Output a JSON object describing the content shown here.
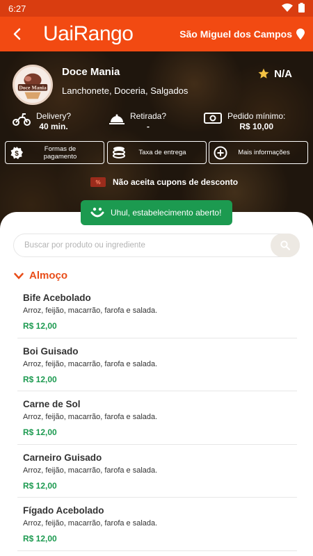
{
  "status_bar": {
    "time": "6:27"
  },
  "app_bar": {
    "logo": "UaiRango",
    "city": "São Miguel dos Campos"
  },
  "store": {
    "name": "Doce Mania",
    "categories": "Lanchonete, Doceria, Salgados",
    "rating": "N/A",
    "logo_text": "Doce Mania",
    "delivery": {
      "label": "Delivery?",
      "value": "40 min."
    },
    "pickup": {
      "label": "Retirada?",
      "value": "-"
    },
    "min_order": {
      "label": "Pedido mínimo:",
      "value": "R$ 10,00"
    },
    "buttons": {
      "payment": "Formas de pagamento",
      "fee": "Taxa de entrega",
      "more": "Mais informações"
    },
    "coupon_notice": "Não aceita cupons de desconto",
    "coupon_tag": "%",
    "open_status": "Uhul, estabelecimento aberto!"
  },
  "search": {
    "placeholder": "Buscar por produto ou ingrediente"
  },
  "section": {
    "title": "Almoço"
  },
  "items": [
    {
      "name": "Bife Acebolado",
      "desc": "Arroz, feijão, macarrão, farofa e salada.",
      "price": "R$ 12,00"
    },
    {
      "name": "Boi Guisado",
      "desc": "Arroz, feijão, macarrão, farofa e salada.",
      "price": "R$ 12,00"
    },
    {
      "name": "Carne de Sol",
      "desc": "Arroz, feijão, macarrão, farofa e salada.",
      "price": "R$ 12,00"
    },
    {
      "name": "Carneiro Guisado",
      "desc": "Arroz, feijão, macarrão, farofa e salada.",
      "price": "R$ 12,00"
    },
    {
      "name": "Fígado Acebolado",
      "desc": "Arroz, feijão, macarrão, farofa e salada.",
      "price": "R$ 12,00"
    }
  ],
  "colors": {
    "brand": "#f24a12",
    "open": "#1c9a50",
    "accent": "#e84d19"
  },
  "icons": [
    "wifi-icon",
    "battery-icon",
    "back-arrow-icon",
    "location-pin-icon",
    "star-icon",
    "motorcycle-icon",
    "cloche-icon",
    "money-icon",
    "dollar-icon",
    "coins-icon",
    "plus-icon",
    "smile-icon",
    "search-icon",
    "chevron-down-icon"
  ]
}
